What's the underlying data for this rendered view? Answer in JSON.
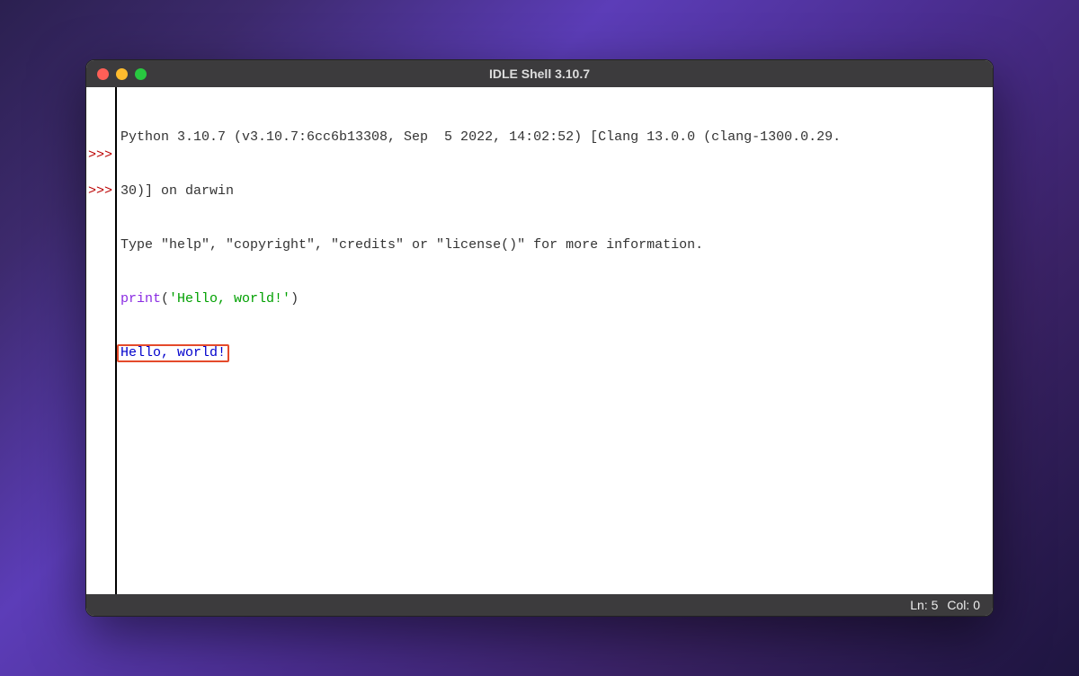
{
  "window": {
    "title": "IDLE Shell 3.10.7"
  },
  "prompt": ">>>",
  "shell": {
    "banner_line1": "Python 3.10.7 (v3.10.7:6cc6b13308, Sep  5 2022, 14:02:52) [Clang 13.0.0 (clang-1300.0.29.",
    "banner_line2": "30)] on darwin",
    "banner_line3": "Type \"help\", \"copyright\", \"credits\" or \"license()\" for more information.",
    "input_fn": "print",
    "input_paren_open": "(",
    "input_str": "'Hello, world!'",
    "input_paren_close": ")",
    "output": "Hello, world!"
  },
  "status": {
    "ln_label": "Ln:",
    "ln_value": "5",
    "col_label": "Col:",
    "col_value": "0"
  }
}
